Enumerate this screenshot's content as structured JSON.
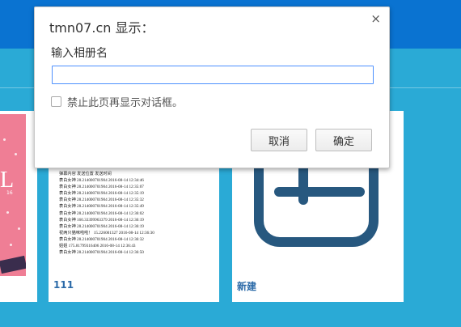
{
  "dialog": {
    "title": "tmn07.cn 显示：",
    "close_symbol": "×",
    "message": "输入相册名",
    "input_value": "",
    "checkbox_label": "禁止此页再显示对话框。",
    "cancel_label": "取消",
    "ok_label": "确定"
  },
  "albums": [
    {
      "cover_letter": "L",
      "cover_number": "16"
    },
    {
      "name": "111",
      "log_header": "弹幕内容 发送位置 发送时间",
      "log_lines": [
        "表白女神 28.2140007019​04 2016-08-14 12:34:46",
        "表白女神 28.214000701904 2016-08-14 12:35:07",
        "表白女神 28.214000701904 2016-08-14 12:35:19",
        "表白女神 28.214000701904 2016-08-14 12:35:32",
        "表白女神 28.214000701904 2016-08-14 12:35:49",
        "表白女神 28.214000701904 2016-08-14 12:36:02",
        "表白女神 160.33399963379 2016-08-14 12:36:19",
        "表白女神 28.214000701904 2016-08-14 12:36:19",
        "祝两只猫咪啦啦！ 15.226001327 2016-08-14 12:36:30",
        "表白女神 28.214000701904 2016-08-14 12:36:32",
        "姐姐 175.81799316406 2016-08-14 12:36:43",
        "表白女神 28.214000701904 2016-08-14 12:36:50"
      ]
    },
    {
      "name": "新建"
    }
  ],
  "colors": {
    "page_bg": "#2aaad6",
    "top_bar": "#0a73d1",
    "plus_icon": "#27587f",
    "album_label": "#2b6aa8",
    "input_focus": "#4d90fe"
  }
}
